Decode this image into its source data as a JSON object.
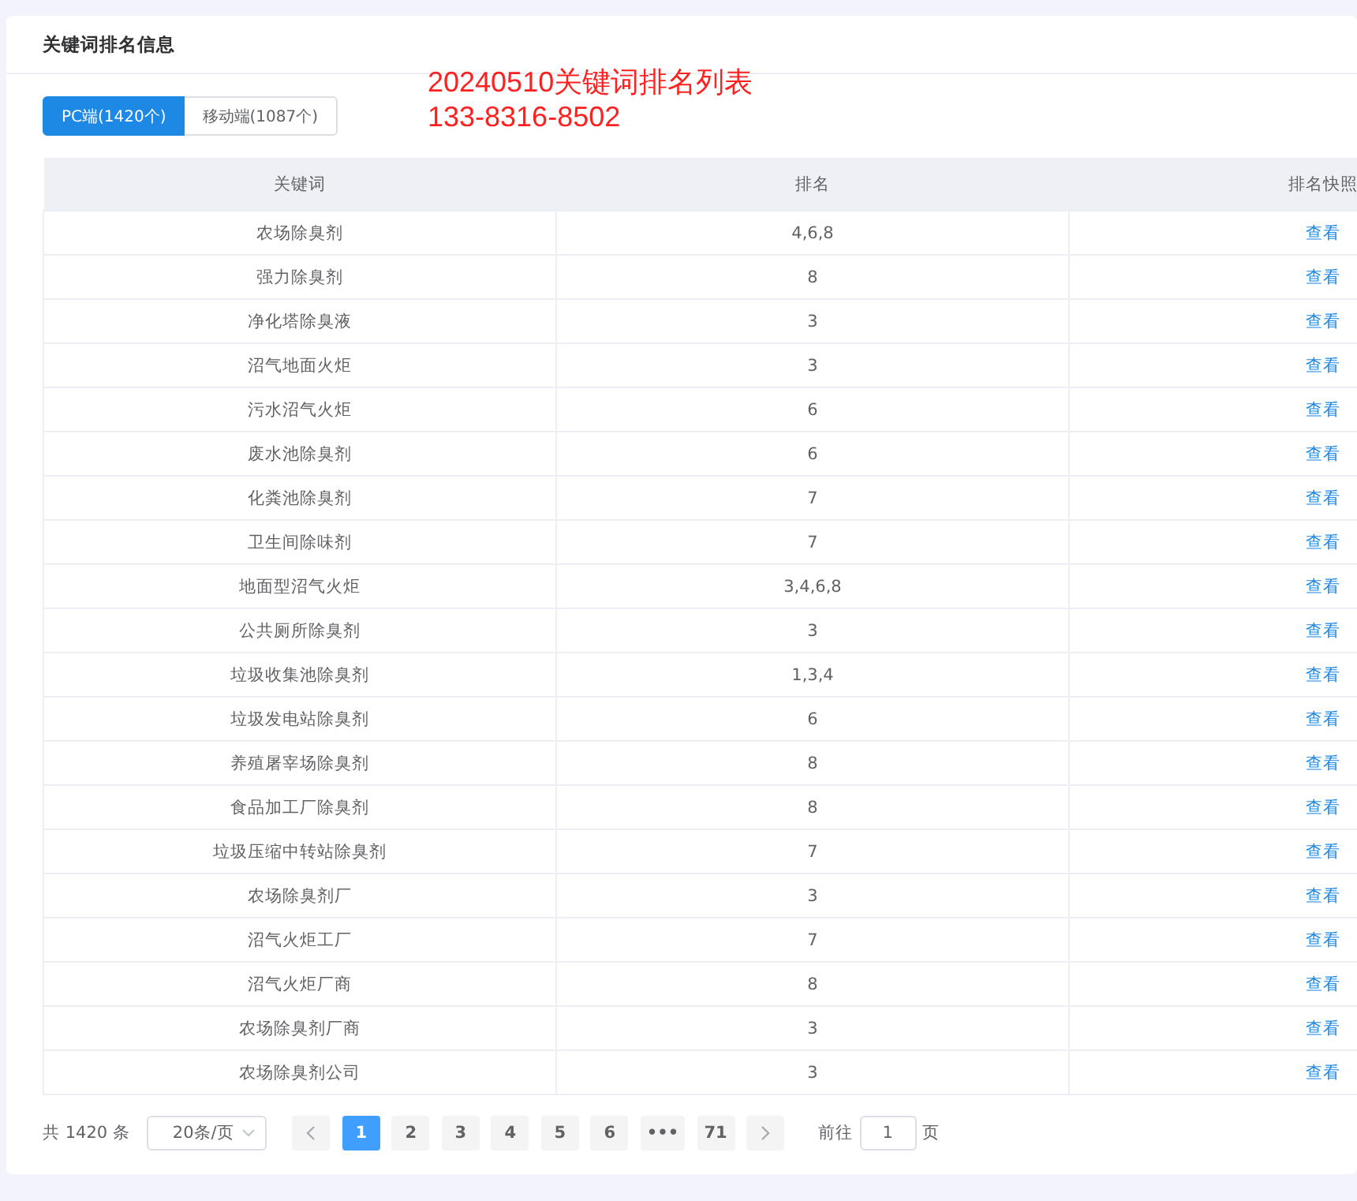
{
  "panel": {
    "title": "关键词排名信息"
  },
  "annotation": {
    "lines": [
      "20240510关键词排名列表",
      "133-8316-8502"
    ]
  },
  "tabs": [
    {
      "label": "PC端(1420个)",
      "selected": true
    },
    {
      "label": "移动端(1087个)",
      "selected": false
    }
  ],
  "table": {
    "columns": [
      "关键词",
      "排名",
      "排名快照"
    ],
    "rows": [
      [
        "农场除臭剂",
        "4,6,8",
        "查看"
      ],
      [
        "强力除臭剂",
        "8",
        "查看"
      ],
      [
        "净化塔除臭液",
        "3",
        "查看"
      ],
      [
        "沼气地面火炬",
        "3",
        "查看"
      ],
      [
        "污水沼气火炬",
        "6",
        "查看"
      ],
      [
        "废水池除臭剂",
        "6",
        "查看"
      ],
      [
        "化粪池除臭剂",
        "7",
        "查看"
      ],
      [
        "卫生间除味剂",
        "7",
        "查看"
      ],
      [
        "地面型沼气火炬",
        "3,4,6,8",
        "查看"
      ],
      [
        "公共厕所除臭剂",
        "3",
        "查看"
      ],
      [
        "垃圾收集池除臭剂",
        "1,3,4",
        "查看"
      ],
      [
        "垃圾发电站除臭剂",
        "6",
        "查看"
      ],
      [
        "养殖屠宰场除臭剂",
        "8",
        "查看"
      ],
      [
        "食品加工厂除臭剂",
        "8",
        "查看"
      ],
      [
        "垃圾压缩中转站除臭剂",
        "7",
        "查看"
      ],
      [
        "农场除臭剂厂",
        "3",
        "查看"
      ],
      [
        "沼气火炬工厂",
        "7",
        "查看"
      ],
      [
        "沼气火炬厂商",
        "8",
        "查看"
      ],
      [
        "农场除臭剂厂商",
        "3",
        "查看"
      ],
      [
        "农场除臭剂公司",
        "3",
        "查看"
      ]
    ]
  },
  "pagination": {
    "total": "共 1420 条",
    "page_size": "20条/页",
    "pages": [
      {
        "label": "1",
        "selected": true
      },
      {
        "label": "2",
        "selected": false
      },
      {
        "label": "3",
        "selected": false
      },
      {
        "label": "4",
        "selected": false
      },
      {
        "label": "5",
        "selected": false
      },
      {
        "label": "6",
        "selected": false
      },
      {
        "label": "•••",
        "selected": false
      },
      {
        "label": "71",
        "selected": false
      }
    ],
    "goto_label": "前往",
    "goto_value": "1",
    "goto_unit": "页"
  }
}
